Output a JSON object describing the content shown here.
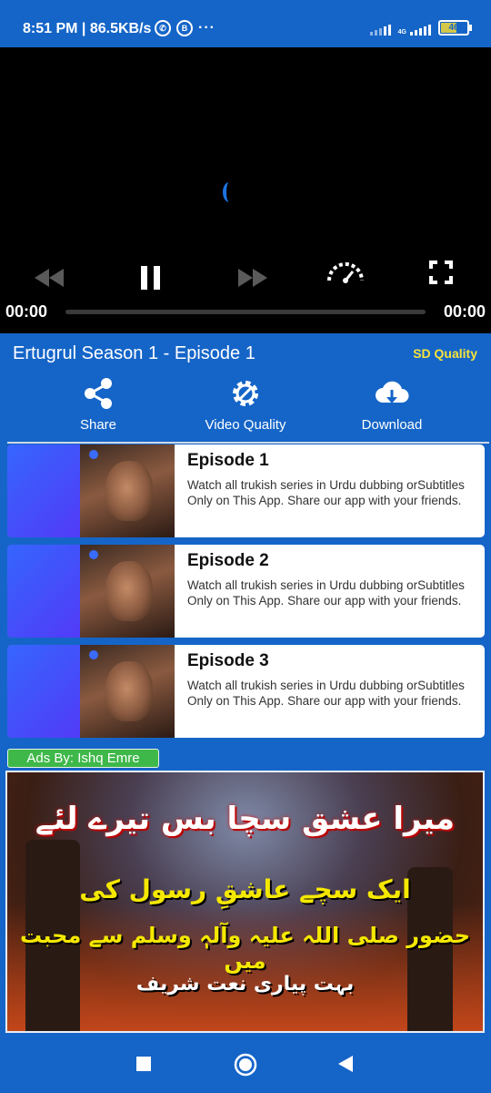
{
  "status_bar": {
    "time": "8:51 PM | 86.5KB/s",
    "network": "4G",
    "battery": "46"
  },
  "player": {
    "current_time": "00:00",
    "total_time": "00:00"
  },
  "episode": {
    "title": "Ertugrul Season 1 - Episode 1",
    "quality": "SD Quality"
  },
  "actions": [
    {
      "label": "Share"
    },
    {
      "label": "Video Quality"
    },
    {
      "label": "Download"
    }
  ],
  "episodes": [
    {
      "title": "Episode 1",
      "description": "Watch all trukish series in Urdu dubbing orSubtitles Only on This App. Share our app with your friends."
    },
    {
      "title": "Episode 2",
      "description": "Watch all trukish series in Urdu dubbing orSubtitles Only on This App. Share our app with your friends."
    },
    {
      "title": "Episode 3",
      "description": "Watch all trukish series in Urdu dubbing orSubtitles Only on This App. Share our app with your friends."
    }
  ],
  "ads": {
    "badge": "Ads By: Ishq Emre",
    "lines": [
      "میرا عشق سچا بس تیرے لئے",
      "ایک سچے عاشقِ رسول کی",
      "حضور صلی اللہ علیہ وآلہٖ وسلم سے محبت میں",
      "بہت پیاری نعت شریف"
    ]
  },
  "colors": {
    "background": "#1565c8",
    "quality_accent": "#f7e23a",
    "ads_badge": "#3fb84a"
  }
}
